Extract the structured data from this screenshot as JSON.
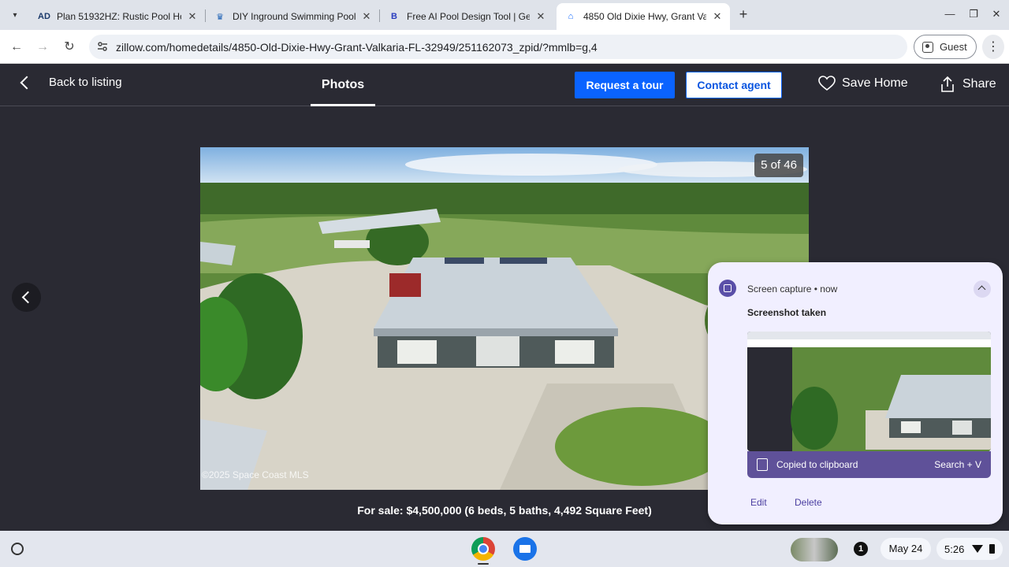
{
  "browser": {
    "tabs": [
      {
        "title": "Plan 51932HZ: Rustic Pool Ho",
        "favicon": "AD",
        "active": false
      },
      {
        "title": "DIY Inground Swimming Pool K",
        "favicon": "crown",
        "active": false
      },
      {
        "title": "Free AI Pool Design Tool | Gene",
        "favicon": "B",
        "active": false
      },
      {
        "title": "4850 Old Dixie Hwy, Grant Valk",
        "favicon": "Z",
        "active": true
      }
    ],
    "url": "zillow.com/homedetails/4850-Old-Dixie-Hwy-Grant-Valkaria-FL-32949/251162073_zpid/?mmlb=g,4",
    "profile_label": "Guest"
  },
  "listing": {
    "back_label": "Back to listing",
    "photos_tab": "Photos",
    "request_tour": "Request a tour",
    "contact_agent": "Contact agent",
    "save_home": "Save Home",
    "share": "Share",
    "photo_counter": "5 of 46",
    "photo_credit": "©2025 Space Coast MLS",
    "caption": "For sale: $4,500,000 (6 beds, 5 baths, 4,492 Square Feet)"
  },
  "notification": {
    "app": "Screen capture",
    "time": "now",
    "title": "Screenshot taken",
    "clipboard_text": "Copied to clipboard",
    "search_hint": "Search + V",
    "edit": "Edit",
    "delete": "Delete"
  },
  "shelf": {
    "badge_count": "1",
    "date": "May 24",
    "time": "5:26"
  },
  "colors": {
    "zillow_blue": "#0a63ff",
    "lightbox_bg": "#2a2a33",
    "notification_accent": "#5f5199"
  }
}
